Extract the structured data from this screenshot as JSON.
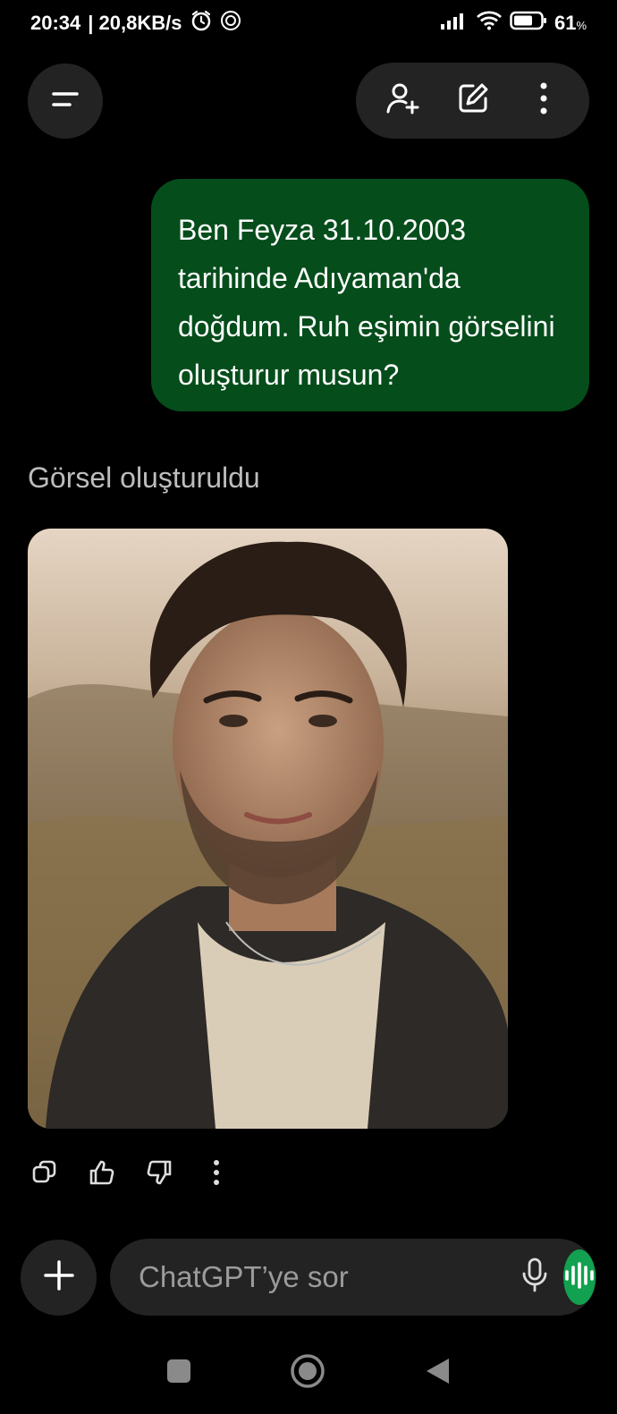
{
  "status_bar": {
    "time": "20:34",
    "net_speed": "| 20,8KB/s",
    "battery_pct": "61",
    "battery_unit": "%",
    "icons": [
      "alarm-icon",
      "chatgpt-notification-icon",
      "signal-icon",
      "wifi-icon",
      "battery-icon"
    ]
  },
  "header": {
    "menu_icon": "menu-icon",
    "actions": [
      "add-person-icon",
      "new-chat-icon",
      "more-vertical-icon"
    ]
  },
  "conversation": {
    "user_message": "Ben Feyza 31.10.2003 tarihinde Adıyaman'da doğdum. Ruh eşimin görselini oluşturur musun?",
    "assistant_status": "Görsel oluşturuldu",
    "image_description_icon": "generated-image",
    "response_actions": [
      "copy-icon",
      "thumbs-up-icon",
      "thumbs-down-icon",
      "more-vertical-icon"
    ]
  },
  "composer": {
    "placeholder": "ChatGPT’ye sor",
    "plus_icon": "plus-icon",
    "mic_icon": "mic-icon",
    "voice_icon": "voice-mode-icon",
    "accent_color": "#12a150"
  },
  "colors": {
    "background": "#000000",
    "user_bubble": "#054d1b",
    "pill": "#232323"
  },
  "nav_bar": {
    "icons": [
      "recents-square-icon",
      "home-circle-icon",
      "back-triangle-icon"
    ]
  }
}
